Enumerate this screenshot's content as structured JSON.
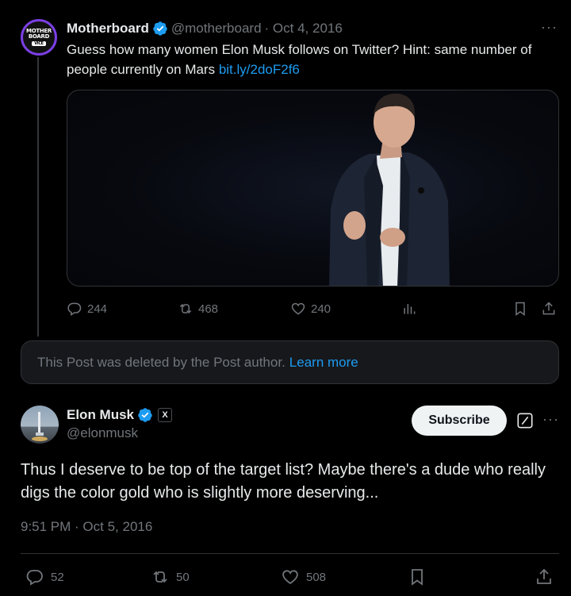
{
  "tweet1": {
    "author_name": "Motherboard",
    "author_handle": "@motherboard",
    "date": "· Oct 4, 2016",
    "text": "Guess how many women Elon Musk follows on Twitter? Hint: same number of people currently on Mars",
    "link": "bit.ly/2doF2f6",
    "avatar_text_line1": "MOTHER",
    "avatar_text_line2": "BOARD",
    "avatar_text_line3": "VICE",
    "stats": {
      "replies": "244",
      "reposts": "468",
      "likes": "240"
    }
  },
  "deleted_notice": {
    "text": "This Post was deleted by the Post author.",
    "link_text": "Learn more"
  },
  "tweet2": {
    "author_name": "Elon Musk",
    "author_handle": "@elonmusk",
    "badge_letter": "X",
    "subscribe_label": "Subscribe",
    "text": "Thus I deserve to be top of the target list? Maybe there's a dude who really digs the color gold who is slightly more deserving...",
    "timestamp": "9:51 PM · Oct 5, 2016",
    "stats": {
      "replies": "52",
      "reposts": "50",
      "likes": "508"
    }
  },
  "colors": {
    "background": "#000000",
    "text": "#e7e9ea",
    "muted": "#71767b",
    "link": "#1d9bf0",
    "verified": "#1d9bf0",
    "card": "#16181c"
  },
  "icons": [
    "reply-icon",
    "repost-icon",
    "like-icon",
    "views-icon",
    "bookmark-icon",
    "share-icon",
    "verified-icon",
    "grok-icon",
    "more-icon"
  ]
}
